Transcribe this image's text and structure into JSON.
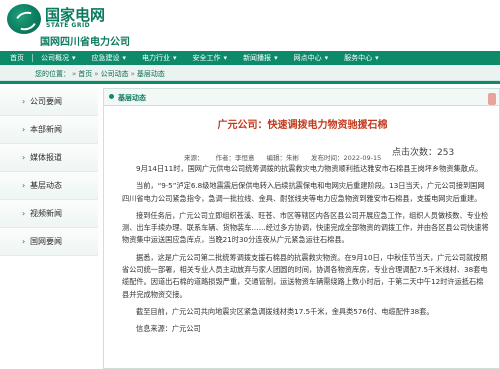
{
  "header": {
    "brand_cn": "国家电网",
    "brand_en": "STATE GRID",
    "brand_sub": "国网四川省电力公司"
  },
  "nav": {
    "items": [
      {
        "label": "首页"
      },
      {
        "label": "公司概况"
      },
      {
        "label": "应急建设"
      },
      {
        "label": "电力行业"
      },
      {
        "label": "安全工作"
      },
      {
        "label": "新闻播报"
      },
      {
        "label": "网点中心"
      },
      {
        "label": "服务中心"
      }
    ]
  },
  "breadcrumb": {
    "prefix": "您的位置：",
    "home": "首页",
    "level2": "公司动态",
    "level3": "基层动态"
  },
  "sidebar": {
    "items": [
      {
        "label": "公司要闻"
      },
      {
        "label": "本部新闻"
      },
      {
        "label": "媒体报道"
      },
      {
        "label": "基层动态"
      },
      {
        "label": "视频新闻"
      },
      {
        "label": "国网要闻"
      }
    ]
  },
  "panel": {
    "section_title": "基层动态",
    "article_title": "广元公司：快速调拨电力物资驰援石棉",
    "meta_source": "来源：",
    "meta_author": "作者：李恒意",
    "meta_editor": "编辑：朱彬",
    "meta_time": "发布时间：2022-09-15",
    "meta_views_label": "点击次数：",
    "views": "253",
    "paragraphs": [
      "9月14日11时，国网广元供电公司统筹调拨的抗震救灾电力物资顺利抵达雅安市石棉县王岗坪乡物资集散点。",
      "当前，“9·5”泸定6.8级地震震后保供电转入后续抗震保电和电网灾后重建阶段。13日当天，广元公司接到国网四川省电力公司紧急指令，急调一批拉线、金具、耐张线夹等电力应急物资到雅安市石棉县，支援电网灾后重建。",
      "接到任务后，广元公司立即组织苍溪、旺苍、市区等辖区内各区县公司开展应急工作，组织人员做核数、专业检测、出车手续办理、联系车辆、货物装车……经过多方协调，快速完成全部物资的调拨工作，并由各区县公司快速将物资集中运送国应急库点，当晚21时30分连夜从广元紧急运往石棉县。",
      "据悉，这是广元公司第二批统筹调拨支援石棉县的抗震救灾物资。在9月10日，中秋佳节当天，广元公司就按照省公司统一部署，相关专业人员主动放弃与家人团圆的时间，协调各物资库房，专业合理调配7.5千米线材、38套电缆配件。因道出石棉的道路损毁严重，交通管制，运送物资车辆需绕路上数小时后，于第二天中午12时许运抵石棉县并完成物资交接。",
      "截至目前，广元公司共向地震灾区紧急调拨线材类17.5千米，金具类576付、电缆配件38套。",
      "信息来源：广元公司"
    ]
  },
  "colors": {
    "brand_green": "#0d8a6a",
    "title_red": "#c23a1e"
  }
}
